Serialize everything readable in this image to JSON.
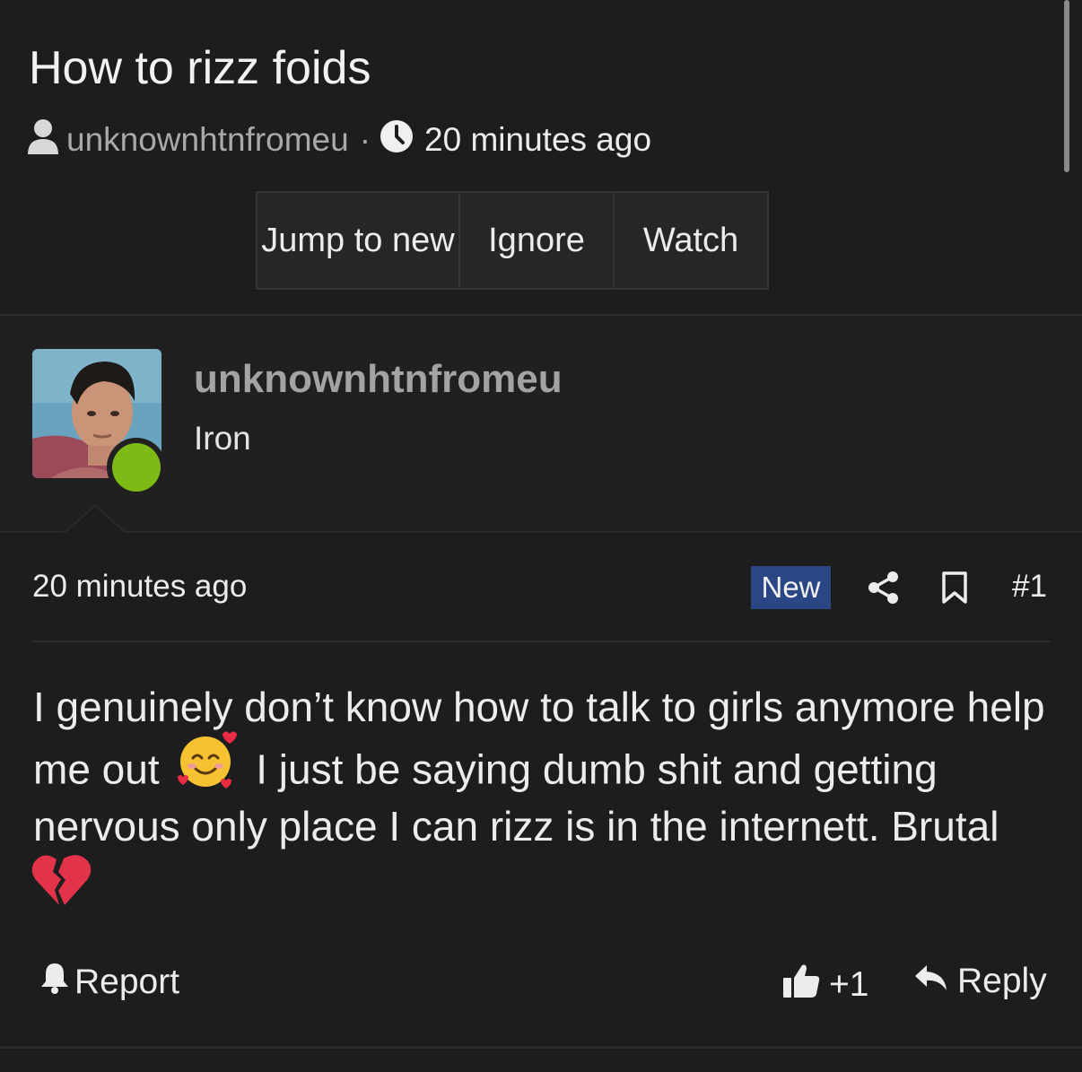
{
  "thread": {
    "title": "How to rizz foids",
    "author": "unknownhtnfromeu",
    "separator": "·",
    "time": "20 minutes ago",
    "buttons": [
      "Jump to new",
      "Ignore",
      "Watch"
    ]
  },
  "post": {
    "username": "unknownhtnfromeu",
    "user_title": "Iron",
    "time": "20 minutes ago",
    "badge": "New",
    "number": "#1",
    "body": {
      "line1": "I genuinely don’t know how to talk to girls anymore help",
      "line2_a": "me out",
      "line2_b": "I just be saying dumb shit and getting",
      "line3": "nervous only place I can rizz is in the internett. Brutal"
    },
    "emojis": [
      "smiling-face-with-hearts",
      "broken-heart"
    ],
    "footer": {
      "report": "Report",
      "like_count": "+1",
      "reply": "Reply"
    }
  },
  "colors": {
    "background": "#1d1d1d",
    "online": "#7dba15",
    "badge": "#2a4685"
  }
}
